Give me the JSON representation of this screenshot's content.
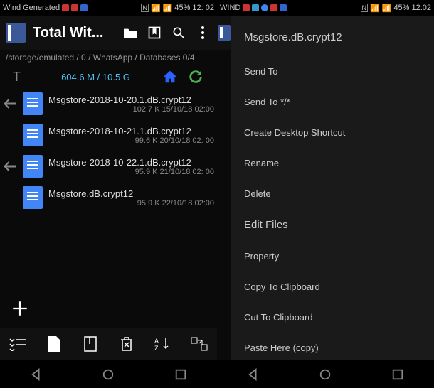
{
  "status": {
    "carrier_left": "Wind Generated",
    "carrier_right": "WIND",
    "battery": "45%",
    "time_left": "12: 02",
    "time_right": "12:02"
  },
  "appbar": {
    "title": "Total Wit..."
  },
  "path": "/storage/emulated / 0 / WhatsApp / Databases 0/4",
  "storage": "604.6 M / 10.5 G",
  "files": [
    {
      "name": "Msgstore-2018-10-20.1.dB.crypt12",
      "meta": "102.7 K 15/10/18 02:00"
    },
    {
      "name": "Msgstore-2018-10-21.1.dB.crypt12",
      "meta": "99.6 K 20/10/18 02: 00"
    },
    {
      "name": "Msgstore-2018-10-22.1.dB.crypt12",
      "meta": "95.9 K 21/10/18 02: 00"
    },
    {
      "name": "Msgstore.dB.crypt12",
      "meta": "95.9 K 22/10/18 02:00"
    }
  ],
  "context": {
    "header": "Msgstore.dB.crypt12",
    "items": [
      "Send To",
      "Send To */*",
      "Create Desktop Shortcut",
      "Rename",
      "Delete",
      "Edit Files",
      "Property",
      "Copy To Clipboard",
      "Cut To Clipboard",
      "Paste Here (copy)"
    ]
  },
  "right_path_fragment": "0/4"
}
